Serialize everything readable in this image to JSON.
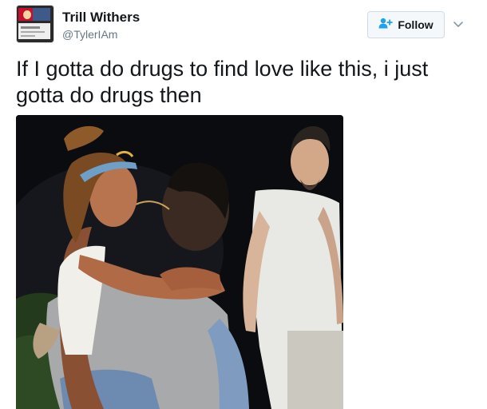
{
  "tweet": {
    "author": {
      "name": "Trill Withers",
      "handle": "@TylerIAm",
      "avatar_text": "Trill Withers"
    },
    "follow_button": {
      "label": "Follow",
      "icon": "add-user-icon",
      "accent_color": "#1da1f2"
    },
    "menu_icon": "chevron-down-icon",
    "text": "If I gotta do drugs to find love like this, i just gotta do drugs then",
    "media": {
      "type": "photo",
      "alt": "Photo of a woman with a headband embracing a man in a gray t-shirt at night while another man in a white t-shirt stands nearby"
    }
  }
}
